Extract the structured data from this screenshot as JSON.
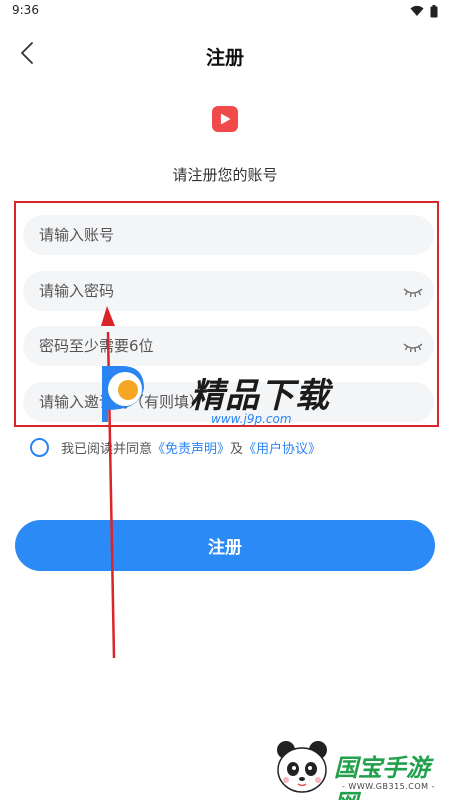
{
  "status_bar": {
    "time": "9:36",
    "wifi_icon": "wifi-icon",
    "battery_icon": "battery-icon"
  },
  "nav": {
    "title": "注册",
    "back_icon": "chevron-left-icon"
  },
  "header": {
    "logo_icon": "play-icon",
    "logo_color": "#f04a4a",
    "subtitle": "请注册您的账号"
  },
  "form": {
    "account_placeholder": "请输入账号",
    "password_placeholder": "请输入密码",
    "confirm_placeholder": "密码至少需要6位",
    "invite_placeholder": "请输入邀请码（有则填）",
    "eye_icon": "eye-closed-icon"
  },
  "agreement": {
    "prefix": "我已阅读并同意",
    "disclaimer_link": "《免责声明》",
    "and": "及",
    "user_agreement_link": "《用户协议》"
  },
  "register_button": "注册",
  "colors": {
    "accent": "#2b8af5",
    "annotation_red": "#d9252a"
  },
  "watermarks": {
    "jingpin_title": "精品下载",
    "jingpin_url": "www.j9p.com",
    "guobao_title": "国宝手游网",
    "guobao_url": "- WWW.GB315.COM -"
  }
}
